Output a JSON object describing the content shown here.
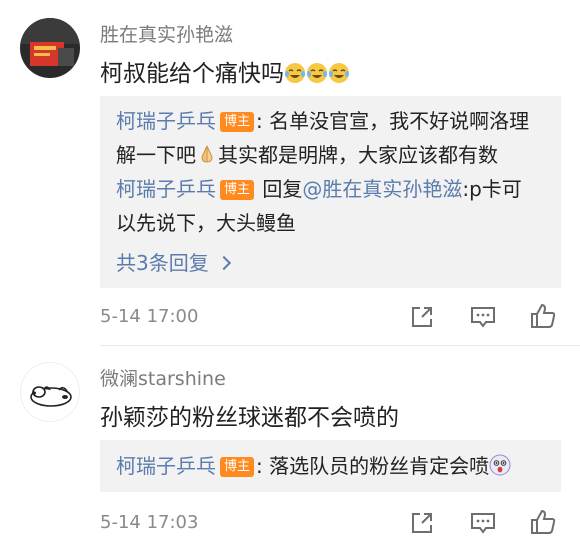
{
  "comments": [
    {
      "username": "胜在真实孙艳滋",
      "text": "柯叔能给个痛快吗",
      "emoji_icons": [
        "laugh-cry-emoji",
        "laugh-cry-emoji",
        "laugh-cry-emoji"
      ],
      "replies": [
        {
          "author": "柯瑞子乒乓",
          "badge": "博主",
          "line1": ": 名单没官宣，我不好说啊洛理",
          "line2": "解一下吧",
          "line2_emoji": "pray-emoji",
          "line2_rest": "其实都是明牌，大家应该都有数"
        },
        {
          "author": "柯瑞子乒乓",
          "badge": "博主",
          "reply_word": " 回复",
          "mention": "@胜在真实孙艳滋",
          "line1_rest": ":p卡可",
          "line2": "以先说下，大头鳗鱼"
        }
      ],
      "more_replies": "共3条回复",
      "timestamp": "5-14 17:00"
    },
    {
      "username": "微澜starshine",
      "text": "孙颖莎的粉丝球迷都不会喷的",
      "replies": [
        {
          "author": "柯瑞子乒乓",
          "badge": "博主",
          "text": ": 落选队员的粉丝肯定会喷",
          "emoji": "shocked-emoji"
        }
      ],
      "timestamp": "5-14 17:03"
    }
  ],
  "actions": {
    "share": "share-icon",
    "comment": "comment-icon",
    "like": "like-icon"
  },
  "colors": {
    "link": "#5b7cad",
    "badge": "#ff8a1f",
    "reply_bg": "#f2f2f2"
  }
}
